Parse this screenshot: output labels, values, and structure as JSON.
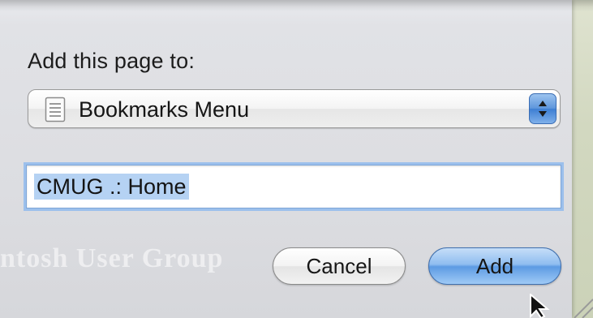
{
  "dialog": {
    "prompt": "Add this page to:",
    "folder_popup": {
      "value": "Bookmarks Menu",
      "icon": "bookmarks-menu-icon"
    },
    "name_field": {
      "value": "CMUG .: Home"
    },
    "cancel_label": "Cancel",
    "add_label": "Add"
  },
  "background": {
    "watermark_text": "ntosh User Group"
  },
  "colors": {
    "default_button": "#5d9be3",
    "focus_ring": "#9cc0ec",
    "selection": "#b5d2f3"
  }
}
